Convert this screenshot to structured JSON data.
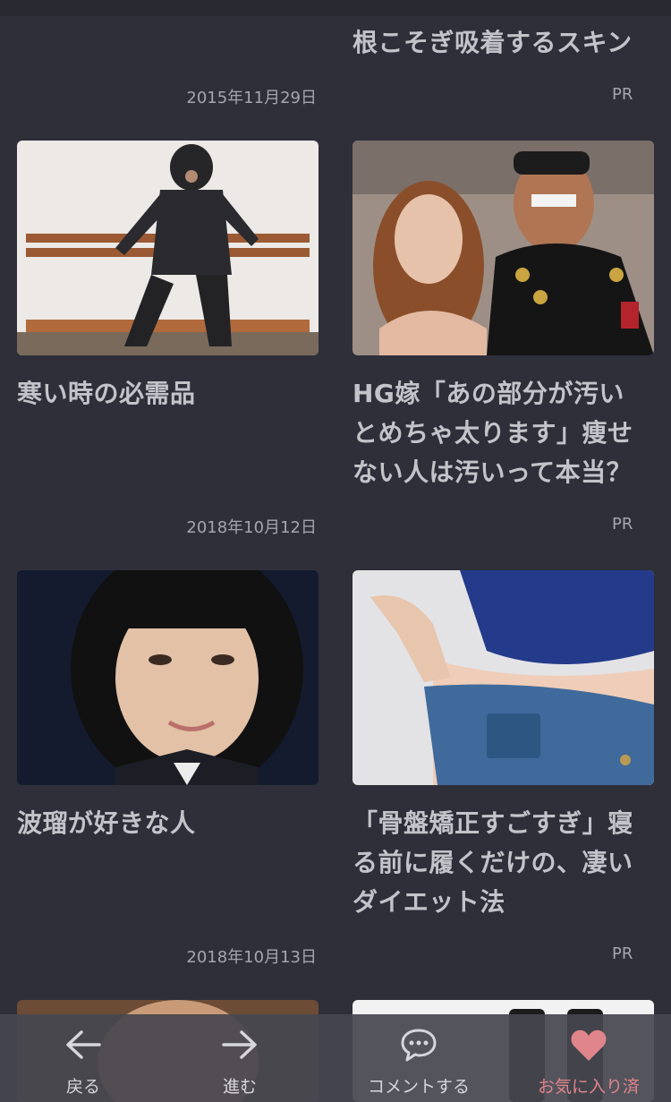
{
  "top_item": {
    "title_tail": "根こそぎ吸着するスキン"
  },
  "rows": [
    {
      "date": "2015年11月29日",
      "pr": "PR"
    },
    {
      "date": "2018年10月12日",
      "pr": "PR"
    },
    {
      "date": "2018年10月13日",
      "pr": "PR"
    }
  ],
  "cards": {
    "left_1": {
      "title": "寒い時の必需品"
    },
    "right_1": {
      "title_lines": [
        "HG嫁「あの部分が汚い",
        "とめちゃ太ります」痩せ",
        "ない人は汚いって本当？"
      ]
    },
    "left_2": {
      "title": "波瑠が好きな人"
    },
    "right_2": {
      "title_lines": [
        "「骨盤矯正すごすぎ」寝",
        "る前に履くだけの、凄い",
        "ダイエット法"
      ]
    }
  },
  "bottom_nav": {
    "back": {
      "label": "戻る",
      "icon": "arrow-left-icon"
    },
    "forward": {
      "label": "進む",
      "icon": "arrow-right-icon"
    },
    "comment": {
      "label": "コメントする",
      "icon": "speech-bubble-icon"
    },
    "favorite": {
      "label": "お気に入り済",
      "icon": "heart-icon",
      "color": "#e0858a"
    }
  },
  "colors": {
    "background": "#2f2f3a",
    "text": "#c3c3c9",
    "favorite": "#e0858a"
  }
}
